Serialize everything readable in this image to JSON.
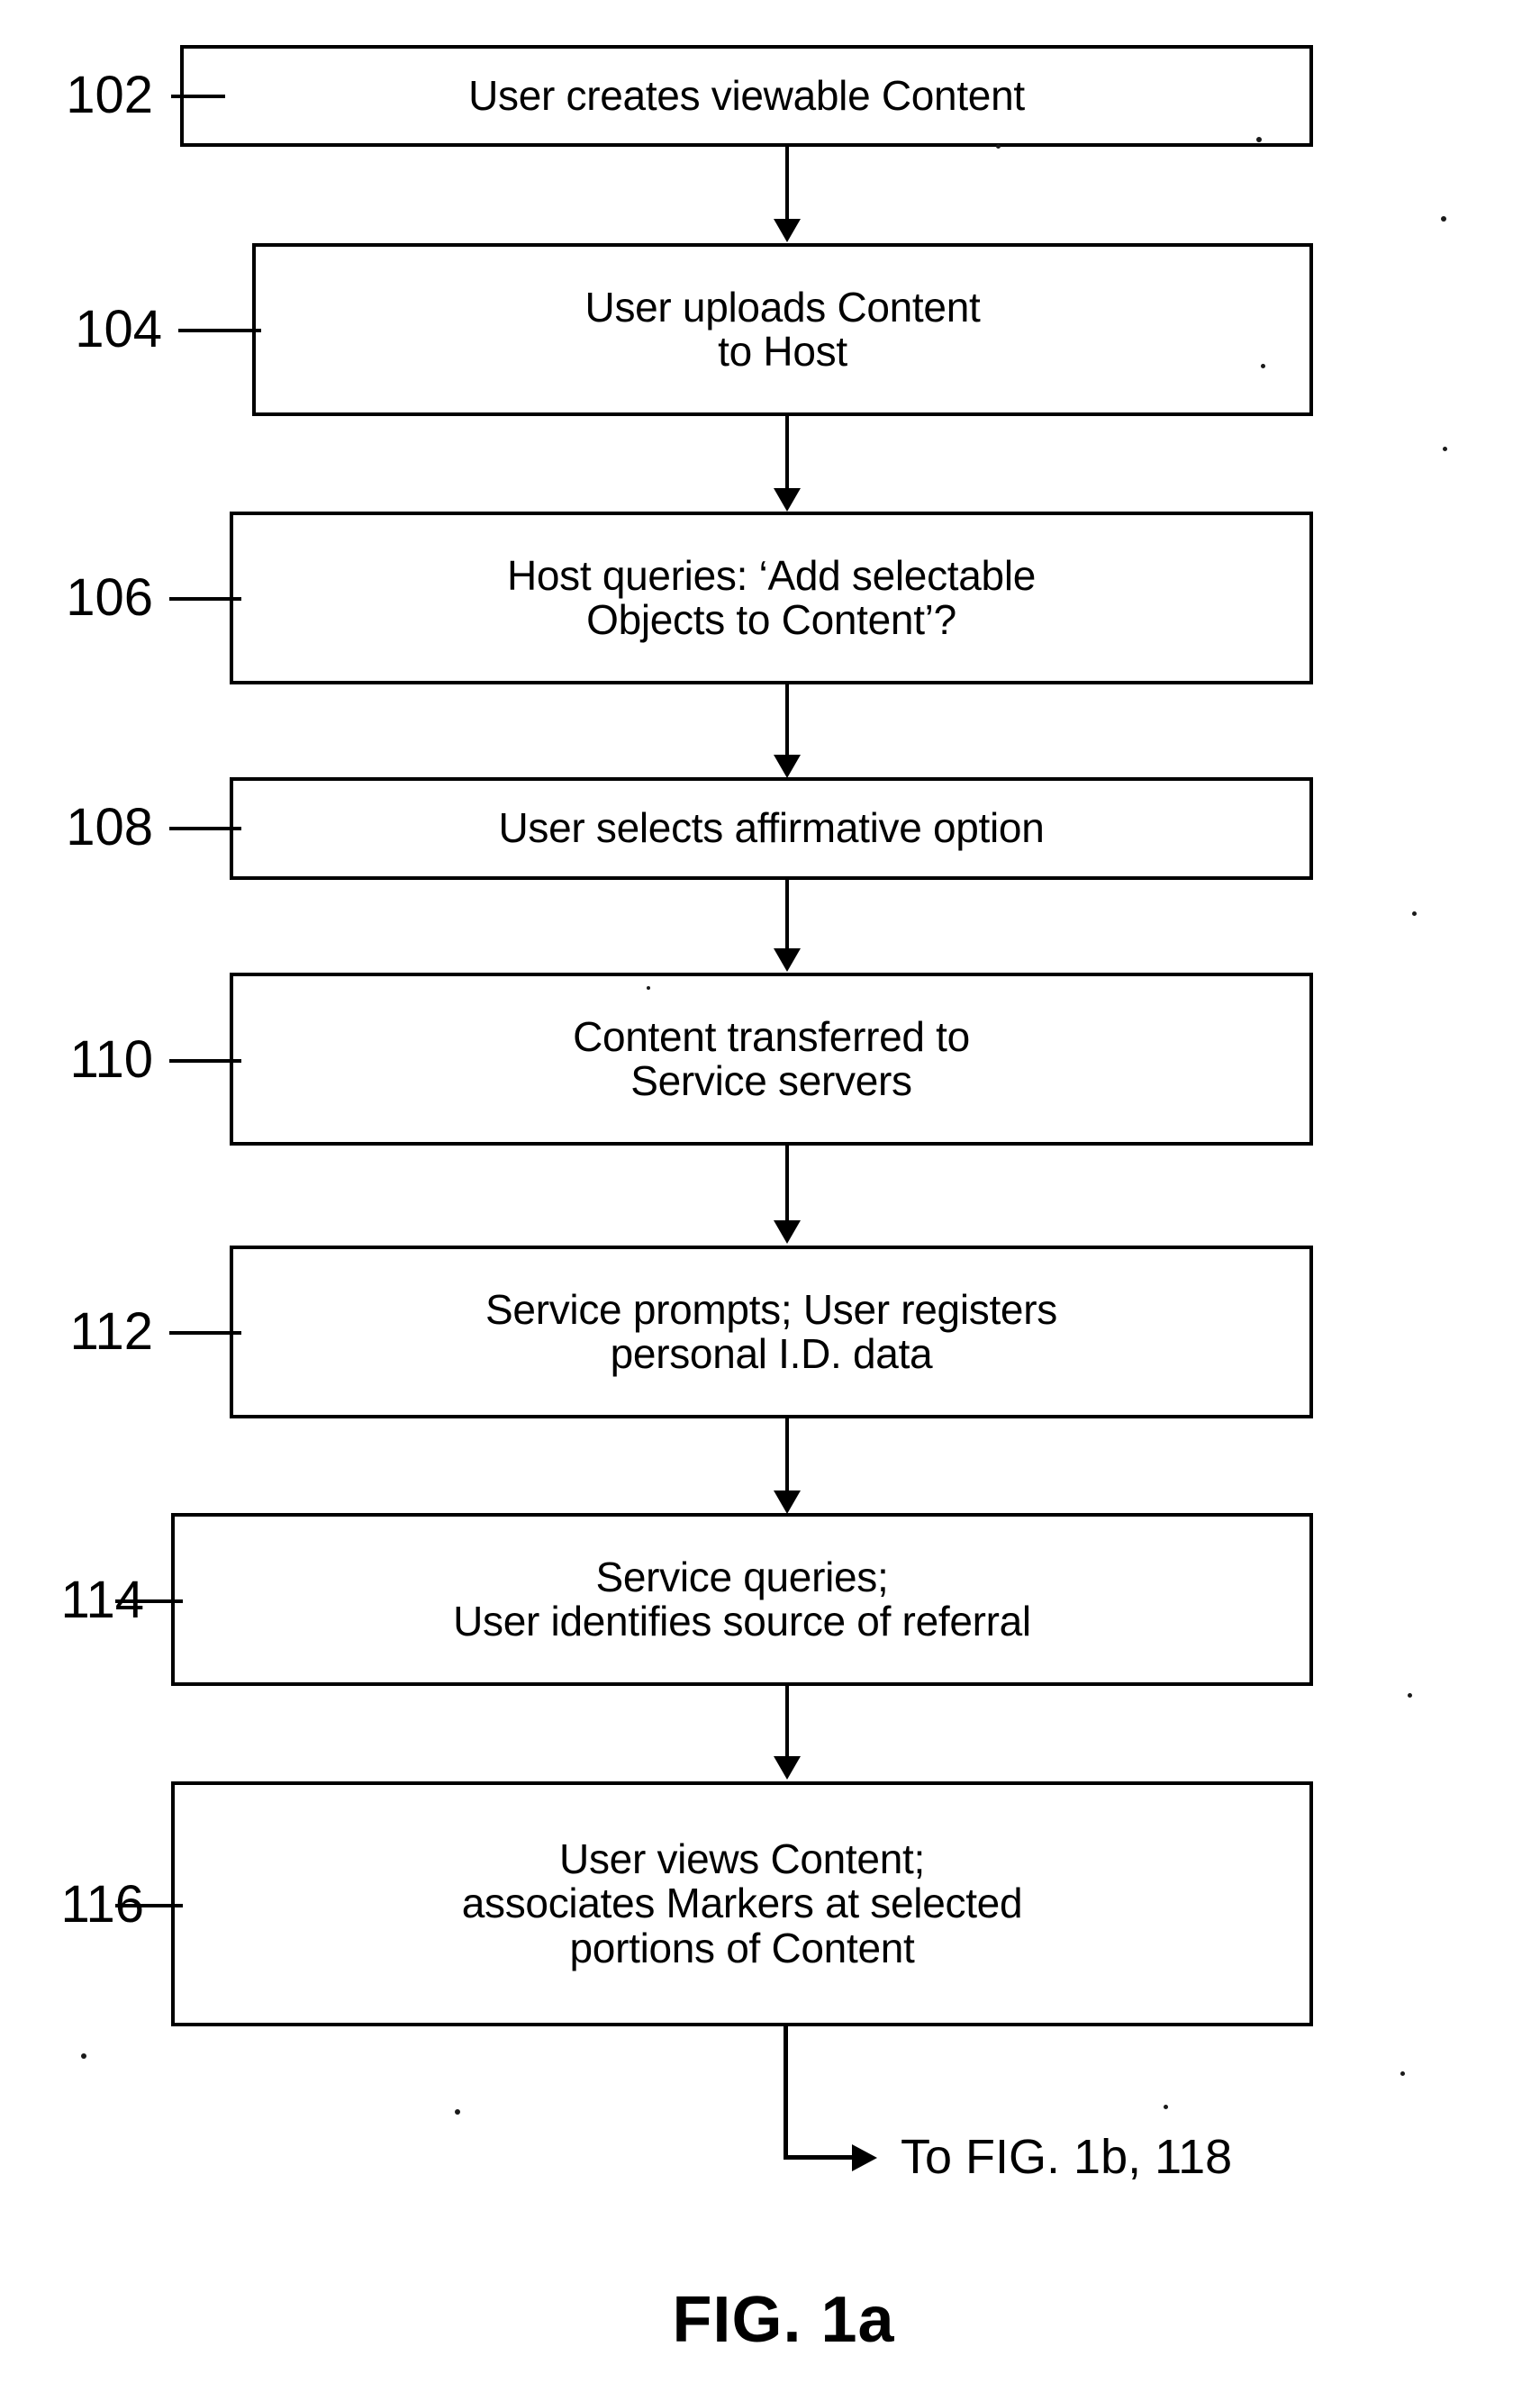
{
  "figure": {
    "caption": "FIG. 1a",
    "exit_label": "To FIG. 1b, 118"
  },
  "nodes": [
    {
      "ref": "102",
      "text": "User creates viewable Content"
    },
    {
      "ref": "104",
      "text": "User uploads Content\nto Host"
    },
    {
      "ref": "106",
      "text": "Host queries: ‘Add selectable\nObjects to Content’?"
    },
    {
      "ref": "108",
      "text": "User selects affirmative option"
    },
    {
      "ref": "110",
      "text": "Content transferred to\nService servers"
    },
    {
      "ref": "112",
      "text": "Service prompts; User registers\npersonal I.D. data"
    },
    {
      "ref": "114",
      "text": "Service queries;\nUser identifies source of referral"
    },
    {
      "ref": "116",
      "text": "User views Content;\nassociates Markers at selected\nportions of Content"
    }
  ]
}
